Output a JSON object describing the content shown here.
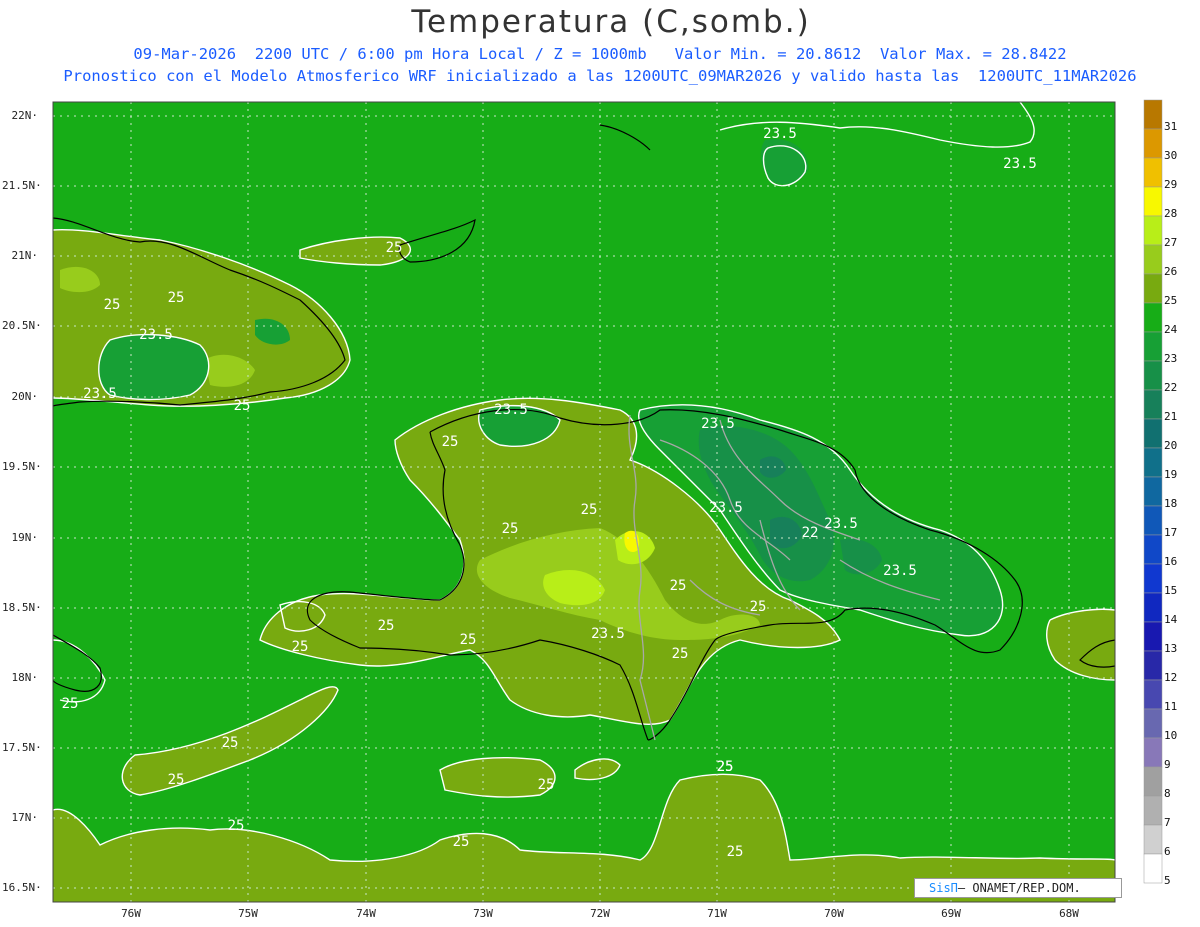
{
  "title": "Temperatura (C,somb.)",
  "subtitle_line1": "09-Mar-2026  2200 UTC / 6:00 pm Hora Local / Z = 1000mb   Valor Min. = 20.8612  Valor Max. = 28.8422",
  "subtitle_line2": "Pronostico con el Modelo Atmosferico WRF inicializado a las 1200UTC_09MAR2026 y valido hasta las  1200UTC_11MAR2026",
  "credit": {
    "brand": "SisΠ",
    "text": "– ONAMET/REP.DOM."
  },
  "lat_labels": [
    "22N",
    "21.5N",
    "21N",
    "20.5N",
    "20N",
    "19.5N",
    "19N",
    "18.5N",
    "18N",
    "17.5N",
    "17N",
    "16.5N"
  ],
  "lon_labels": [
    "76W",
    "75W",
    "74W",
    "73W",
    "72W",
    "71W",
    "70W",
    "69W",
    "68W"
  ],
  "colorbar": {
    "labels": [
      "31",
      "30",
      "29",
      "28",
      "27",
      "26",
      "25",
      "24",
      "23",
      "22",
      "21",
      "20",
      "19",
      "18",
      "17",
      "16",
      "15",
      "14",
      "13",
      "12",
      "11",
      "10",
      "9",
      "8",
      "7",
      "6",
      "5"
    ],
    "colors": [
      "#b87800",
      "#dc9800",
      "#f0c000",
      "#f8f800",
      "#b8ee18",
      "#98cc1c",
      "#78aa10",
      "#17ad17",
      "#17a035",
      "#179048",
      "#17805a",
      "#117070",
      "#10708a",
      "#1068a0",
      "#1058b8",
      "#1048c8",
      "#1038d0",
      "#1028c0",
      "#1818b0",
      "#2828a8",
      "#4848b0",
      "#6868b0",
      "#8878b8",
      "#a0a0a0",
      "#b0b0b0",
      "#d0d0d0",
      "#ffffff"
    ]
  },
  "contour_labels": [
    "23.5",
    "23.5",
    "25",
    "25",
    "25",
    "23.5",
    "23.5",
    "25",
    "23.5",
    "25",
    "23.5",
    "25",
    "25",
    "23.5",
    "22",
    "23.5",
    "23.5",
    "25",
    "25",
    "25",
    "25",
    "23.5",
    "25",
    "25",
    "25",
    "25",
    "25",
    "25",
    "25",
    "25",
    "25",
    "25",
    "25"
  ],
  "colors": {
    "background": "#17ad17",
    "contour": "#ffffff",
    "subtitle": "#1a5cff",
    "coast": "#000000",
    "border": "#a8a8a8"
  }
}
